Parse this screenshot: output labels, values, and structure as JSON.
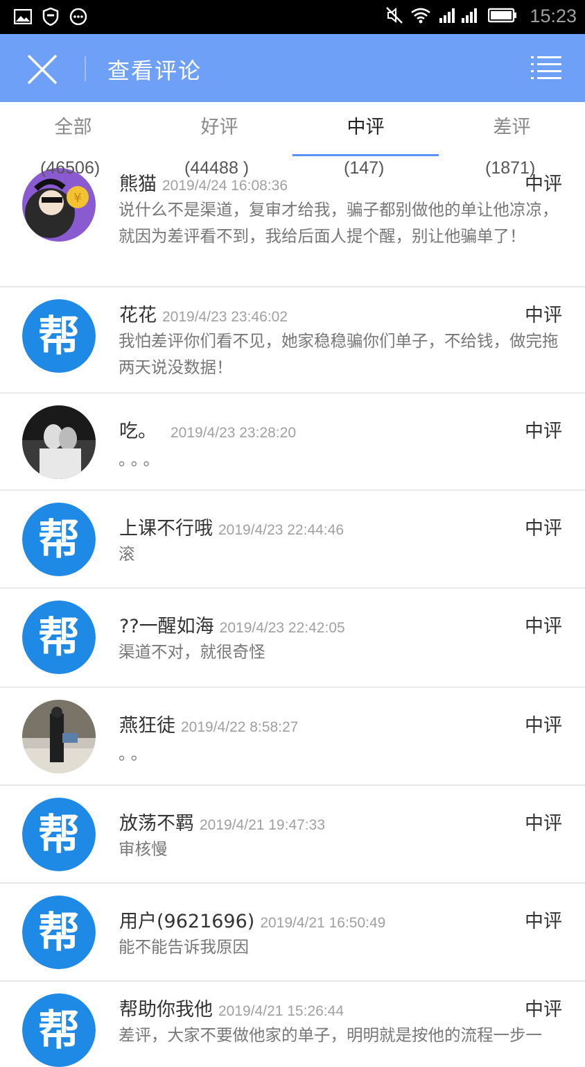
{
  "status_bar": {
    "time": "15:23"
  },
  "header": {
    "title": "查看评论"
  },
  "tabs": [
    {
      "label": "全部",
      "count": "(46506)"
    },
    {
      "label": "好评",
      "count": "(44488 )"
    },
    {
      "label": "中评",
      "count": "(147)"
    },
    {
      "label": "差评",
      "count": "(1871)"
    }
  ],
  "active_tab": 2,
  "reviews": [
    {
      "name": "熊猫",
      "time": "2019/4/24 16:08:36",
      "rating": "中评",
      "content": "说什么不是渠道，复审才给我，骗子都别做他的单让他凉凉，就因为差评看不到，我给后面人提个醒，别让他骗单了！",
      "avatar": "panda"
    },
    {
      "name": "花花",
      "time": "2019/4/23 23:46:02",
      "rating": "中评",
      "content": "我怕差评你们看不见，她家稳稳骗你们单子，不给钱，做完拖两天说没数据！",
      "avatar": "bang"
    },
    {
      "name": "吃。",
      "time": "2019/4/23 23:28:20",
      "rating": "中评",
      "content": "。。。",
      "avatar": "photo-couple"
    },
    {
      "name": "上课不行哦",
      "time": "2019/4/23 22:44:46",
      "rating": "中评",
      "content": "滚",
      "avatar": "bang"
    },
    {
      "name": "??一醒如海",
      "time": "2019/4/23 22:42:05",
      "rating": "中评",
      "content": "渠道不对，就很奇怪",
      "avatar": "bang"
    },
    {
      "name": "燕狂徒",
      "time": "2019/4/22 8:58:27",
      "rating": "中评",
      "content": "。。",
      "avatar": "photo-street"
    },
    {
      "name": "放荡不羁",
      "time": "2019/4/21 19:47:33",
      "rating": "中评",
      "content": "审核慢",
      "avatar": "bang"
    },
    {
      "name": "用户(9621696)",
      "time": "2019/4/21 16:50:49",
      "rating": "中评",
      "content": "能不能告诉我原因",
      "avatar": "bang"
    },
    {
      "name": "帮助你我他",
      "time": "2019/4/21 15:26:44",
      "rating": "中评",
      "content": "差评，大家不要做他家的单子，明明就是按他的流程一步一",
      "avatar": "bang"
    }
  ]
}
